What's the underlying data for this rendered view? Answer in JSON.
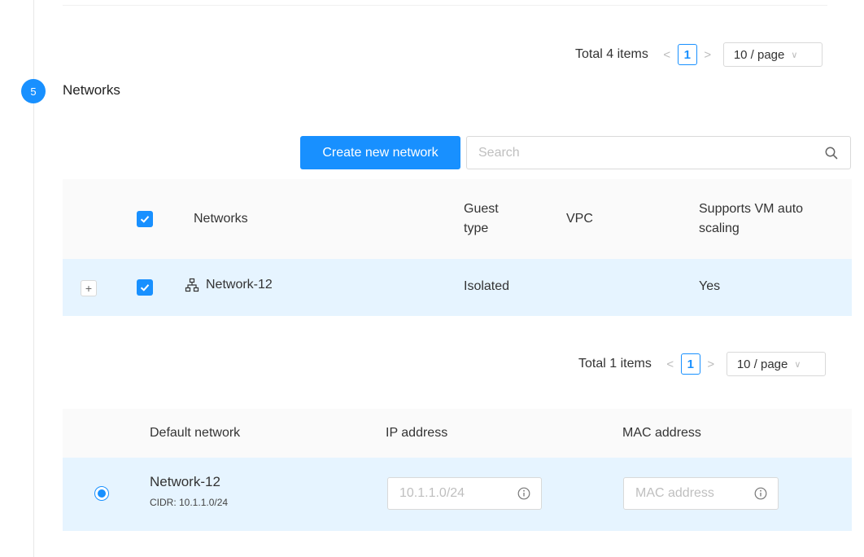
{
  "step": {
    "number": "5",
    "title": "Networks"
  },
  "pagination_top": {
    "total": "Total 4 items",
    "prev": "<",
    "page": "1",
    "next": ">",
    "size": "10 / page",
    "size_chevron": "∨"
  },
  "toolbar": {
    "create_label": "Create new network",
    "search_placeholder": "Search"
  },
  "networks_table": {
    "headers": {
      "networks": "Networks",
      "guest_type_line1": "Guest",
      "guest_type_line2": "type",
      "vpc": "VPC",
      "autoscale_line1": "Supports VM auto",
      "autoscale_line2": "scaling"
    },
    "rows": [
      {
        "expand": "+",
        "name": "Network-12",
        "guest_type": "Isolated",
        "vpc": "",
        "autoscale": "Yes"
      }
    ]
  },
  "pagination_bottom": {
    "total": "Total 1 items",
    "prev": "<",
    "page": "1",
    "next": ">",
    "size": "10 / page",
    "size_chevron": "∨"
  },
  "nic_table": {
    "headers": {
      "default_network": "Default network",
      "ip_address": "IP address",
      "mac_address": "MAC address"
    },
    "rows": [
      {
        "name": "Network-12",
        "cidr": "CIDR: 10.1.1.0/24",
        "ip_placeholder": "10.1.1.0/24",
        "mac_placeholder": "MAC address"
      }
    ]
  },
  "colors": {
    "accent": "#1890ff",
    "row_selected": "#e6f4ff",
    "header_bg": "#fafafa"
  }
}
